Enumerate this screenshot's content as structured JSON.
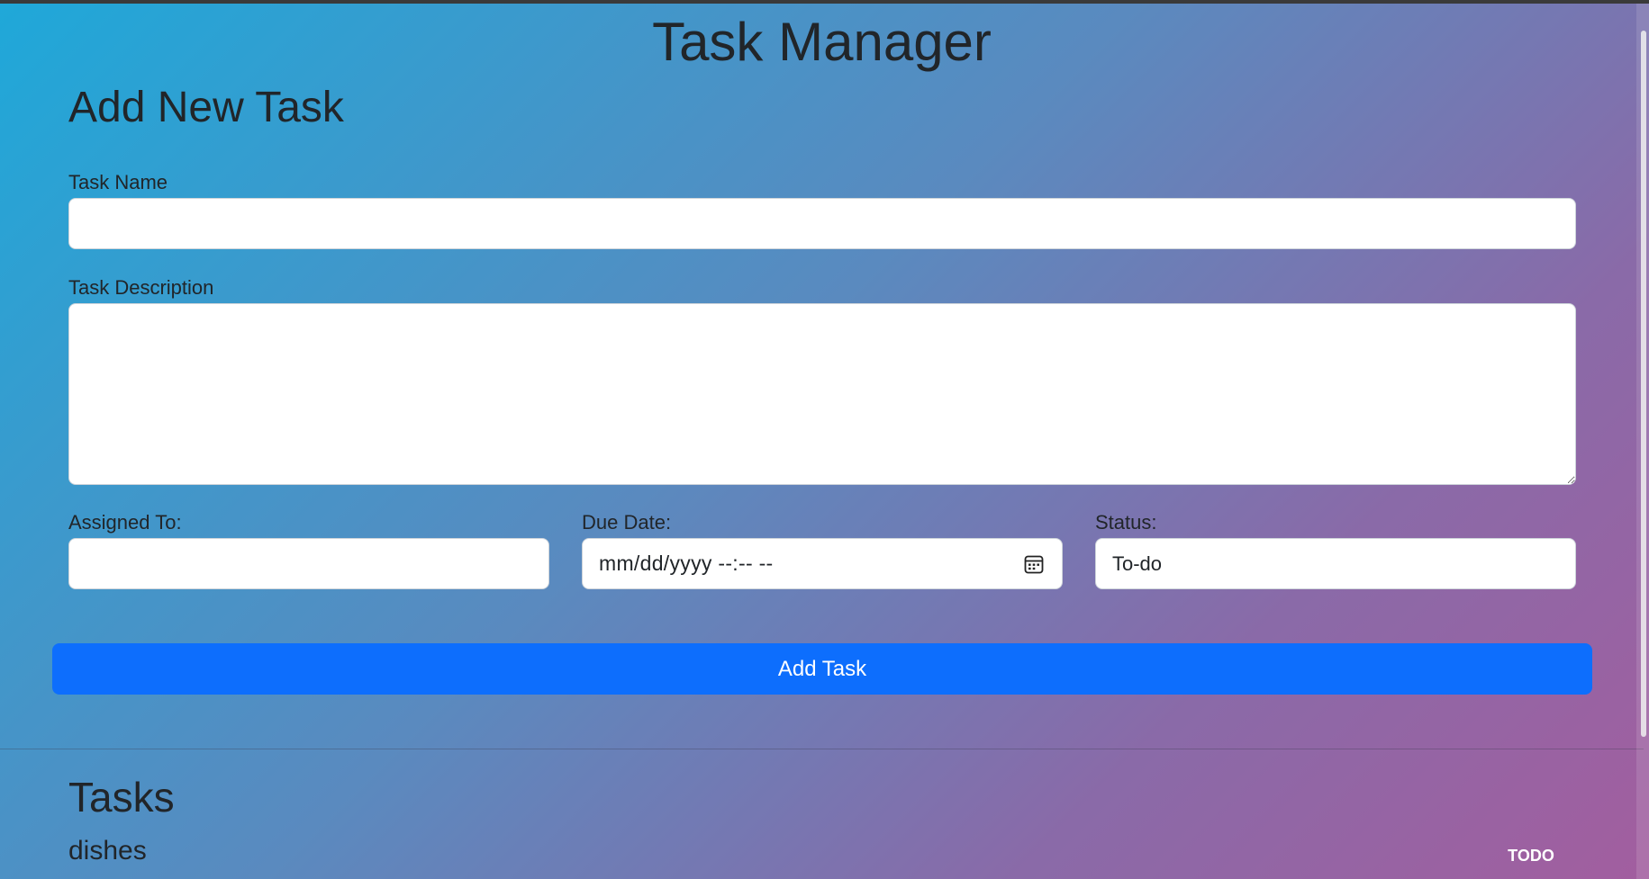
{
  "app": {
    "title": "Task Manager"
  },
  "form": {
    "heading": "Add New Task",
    "task_name": {
      "label": "Task Name",
      "value": ""
    },
    "task_description": {
      "label": "Task Description",
      "value": ""
    },
    "assigned_to": {
      "label": "Assigned To:",
      "value": ""
    },
    "due_date": {
      "label": "Due Date:",
      "placeholder": "mm/dd/yyyy --:-- --",
      "icon": "calendar-icon"
    },
    "status": {
      "label": "Status:",
      "value": "To-do"
    },
    "submit_label": "Add Task"
  },
  "tasks": {
    "heading": "Tasks",
    "items": [
      {
        "name": "dishes",
        "status": "TODO"
      }
    ]
  },
  "colors": {
    "primary_button": "#0d6efd",
    "gradient_start": "#1fa8d9",
    "gradient_end": "#a25e9f"
  }
}
